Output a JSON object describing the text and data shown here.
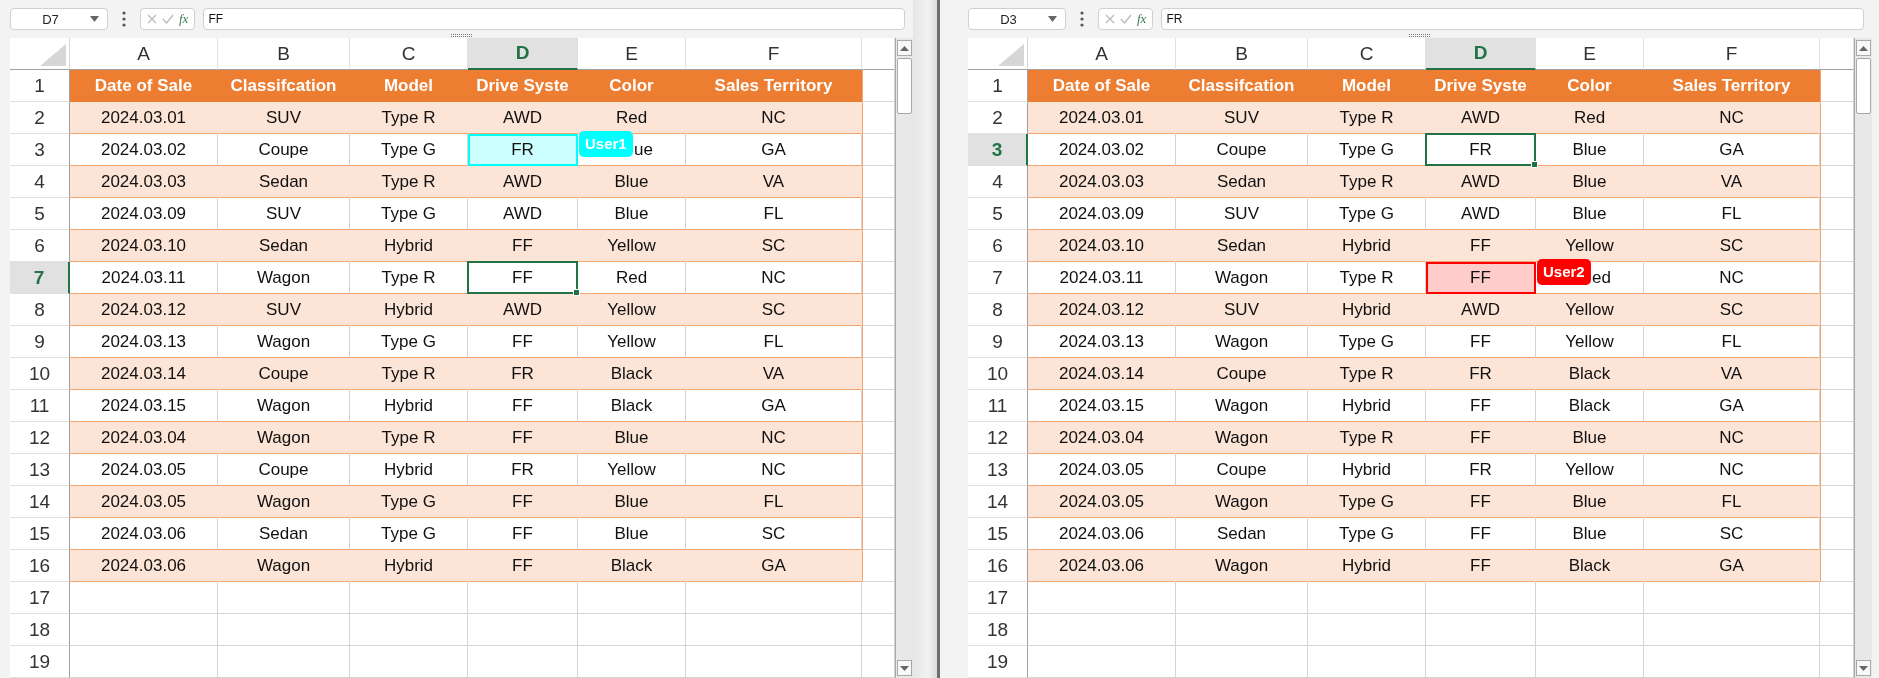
{
  "panes": [
    {
      "name_box": "D7",
      "fx_label": "fx",
      "formula": "FF",
      "columns": [
        {
          "label": "A",
          "selected": false
        },
        {
          "label": "B",
          "selected": false
        },
        {
          "label": "C",
          "selected": false
        },
        {
          "label": "D",
          "selected": true
        },
        {
          "label": "E",
          "selected": false
        },
        {
          "label": "F",
          "selected": false
        }
      ],
      "rows": [
        {
          "number": "1",
          "selected": false,
          "kind": "header",
          "cells": [
            "Date of Sale",
            "Classifcation",
            "Model",
            "Drive Syste",
            "Color",
            "Sales Territory"
          ]
        },
        {
          "number": "2",
          "selected": false,
          "kind": "band",
          "cells": [
            "2024.03.01",
            "SUV",
            "Type R",
            "AWD",
            "Red",
            "NC"
          ]
        },
        {
          "number": "3",
          "selected": false,
          "kind": "plain",
          "cells": [
            "2024.03.02",
            "Coupe",
            "Type G",
            "FR",
            "ue",
            "GA"
          ],
          "collaborator": {
            "name": "User1",
            "color": "#00ffff"
          }
        },
        {
          "number": "4",
          "selected": false,
          "kind": "band",
          "cells": [
            "2024.03.03",
            "Sedan",
            "Type R",
            "AWD",
            "Blue",
            "VA"
          ]
        },
        {
          "number": "5",
          "selected": false,
          "kind": "plain",
          "cells": [
            "2024.03.09",
            "SUV",
            "Type G",
            "AWD",
            "Blue",
            "FL"
          ]
        },
        {
          "number": "6",
          "selected": false,
          "kind": "band",
          "cells": [
            "2024.03.10",
            "Sedan",
            "Hybrid",
            "FF",
            "Yellow",
            "SC"
          ]
        },
        {
          "number": "7",
          "selected": true,
          "kind": "plain",
          "cells": [
            "2024.03.11",
            "Wagon",
            "Type R",
            "FF",
            "Red",
            "NC"
          ]
        },
        {
          "number": "8",
          "selected": false,
          "kind": "band",
          "cells": [
            "2024.03.12",
            "SUV",
            "Hybrid",
            "AWD",
            "Yellow",
            "SC"
          ]
        },
        {
          "number": "9",
          "selected": false,
          "kind": "plain",
          "cells": [
            "2024.03.13",
            "Wagon",
            "Type G",
            "FF",
            "Yellow",
            "FL"
          ]
        },
        {
          "number": "10",
          "selected": false,
          "kind": "band",
          "cells": [
            "2024.03.14",
            "Coupe",
            "Type R",
            "FR",
            "Black",
            "VA"
          ]
        },
        {
          "number": "11",
          "selected": false,
          "kind": "plain",
          "cells": [
            "2024.03.15",
            "Wagon",
            "Hybrid",
            "FF",
            "Black",
            "GA"
          ]
        },
        {
          "number": "12",
          "selected": false,
          "kind": "band",
          "cells": [
            "2024.03.04",
            "Wagon",
            "Type R",
            "FF",
            "Blue",
            "NC"
          ]
        },
        {
          "number": "13",
          "selected": false,
          "kind": "plain",
          "cells": [
            "2024.03.05",
            "Coupe",
            "Hybrid",
            "FR",
            "Yellow",
            "NC"
          ]
        },
        {
          "number": "14",
          "selected": false,
          "kind": "band",
          "cells": [
            "2024.03.05",
            "Wagon",
            "Type G",
            "FF",
            "Blue",
            "FL"
          ]
        },
        {
          "number": "15",
          "selected": false,
          "kind": "plain",
          "cells": [
            "2024.03.06",
            "Sedan",
            "Type G",
            "FF",
            "Blue",
            "SC"
          ]
        },
        {
          "number": "16",
          "selected": false,
          "kind": "band",
          "cells": [
            "2024.03.06",
            "Wagon",
            "Hybrid",
            "FF",
            "Black",
            "GA"
          ]
        },
        {
          "number": "17",
          "selected": false,
          "kind": "empty"
        },
        {
          "number": "18",
          "selected": false,
          "kind": "empty"
        },
        {
          "number": "19",
          "selected": false,
          "kind": "empty"
        }
      ]
    },
    {
      "name_box": "D3",
      "fx_label": "fx",
      "formula": "FR",
      "columns": [
        {
          "label": "A",
          "selected": false
        },
        {
          "label": "B",
          "selected": false
        },
        {
          "label": "C",
          "selected": false
        },
        {
          "label": "D",
          "selected": true
        },
        {
          "label": "E",
          "selected": false
        },
        {
          "label": "F",
          "selected": false
        }
      ],
      "rows": [
        {
          "number": "1",
          "selected": false,
          "kind": "header",
          "cells": [
            "Date of Sale",
            "Classifcation",
            "Model",
            "Drive Syste",
            "Color",
            "Sales Territory"
          ]
        },
        {
          "number": "2",
          "selected": false,
          "kind": "band",
          "cells": [
            "2024.03.01",
            "SUV",
            "Type R",
            "AWD",
            "Red",
            "NC"
          ]
        },
        {
          "number": "3",
          "selected": true,
          "kind": "plain",
          "cells": [
            "2024.03.02",
            "Coupe",
            "Type G",
            "FR",
            "Blue",
            "GA"
          ]
        },
        {
          "number": "4",
          "selected": false,
          "kind": "band",
          "cells": [
            "2024.03.03",
            "Sedan",
            "Type R",
            "AWD",
            "Blue",
            "VA"
          ]
        },
        {
          "number": "5",
          "selected": false,
          "kind": "plain",
          "cells": [
            "2024.03.09",
            "SUV",
            "Type G",
            "AWD",
            "Blue",
            "FL"
          ]
        },
        {
          "number": "6",
          "selected": false,
          "kind": "band",
          "cells": [
            "2024.03.10",
            "Sedan",
            "Hybrid",
            "FF",
            "Yellow",
            "SC"
          ]
        },
        {
          "number": "7",
          "selected": false,
          "kind": "plain",
          "cells": [
            "2024.03.11",
            "Wagon",
            "Type R",
            "FF",
            "ed",
            "NC"
          ],
          "collaborator": {
            "name": "User2",
            "color": "#ff0000"
          }
        },
        {
          "number": "8",
          "selected": false,
          "kind": "band",
          "cells": [
            "2024.03.12",
            "SUV",
            "Hybrid",
            "AWD",
            "Yellow",
            "SC"
          ]
        },
        {
          "number": "9",
          "selected": false,
          "kind": "plain",
          "cells": [
            "2024.03.13",
            "Wagon",
            "Type G",
            "FF",
            "Yellow",
            "FL"
          ]
        },
        {
          "number": "10",
          "selected": false,
          "kind": "band",
          "cells": [
            "2024.03.14",
            "Coupe",
            "Type R",
            "FR",
            "Black",
            "VA"
          ]
        },
        {
          "number": "11",
          "selected": false,
          "kind": "plain",
          "cells": [
            "2024.03.15",
            "Wagon",
            "Hybrid",
            "FF",
            "Black",
            "GA"
          ]
        },
        {
          "number": "12",
          "selected": false,
          "kind": "band",
          "cells": [
            "2024.03.04",
            "Wagon",
            "Type R",
            "FF",
            "Blue",
            "NC"
          ]
        },
        {
          "number": "13",
          "selected": false,
          "kind": "plain",
          "cells": [
            "2024.03.05",
            "Coupe",
            "Hybrid",
            "FR",
            "Yellow",
            "NC"
          ]
        },
        {
          "number": "14",
          "selected": false,
          "kind": "band",
          "cells": [
            "2024.03.05",
            "Wagon",
            "Type G",
            "FF",
            "Blue",
            "FL"
          ]
        },
        {
          "number": "15",
          "selected": false,
          "kind": "plain",
          "cells": [
            "2024.03.06",
            "Sedan",
            "Type G",
            "FF",
            "Blue",
            "SC"
          ]
        },
        {
          "number": "16",
          "selected": false,
          "kind": "band",
          "cells": [
            "2024.03.06",
            "Wagon",
            "Hybrid",
            "FF",
            "Black",
            "GA"
          ]
        },
        {
          "number": "17",
          "selected": false,
          "kind": "empty"
        },
        {
          "number": "18",
          "selected": false,
          "kind": "empty"
        },
        {
          "number": "19",
          "selected": false,
          "kind": "empty"
        }
      ]
    }
  ]
}
